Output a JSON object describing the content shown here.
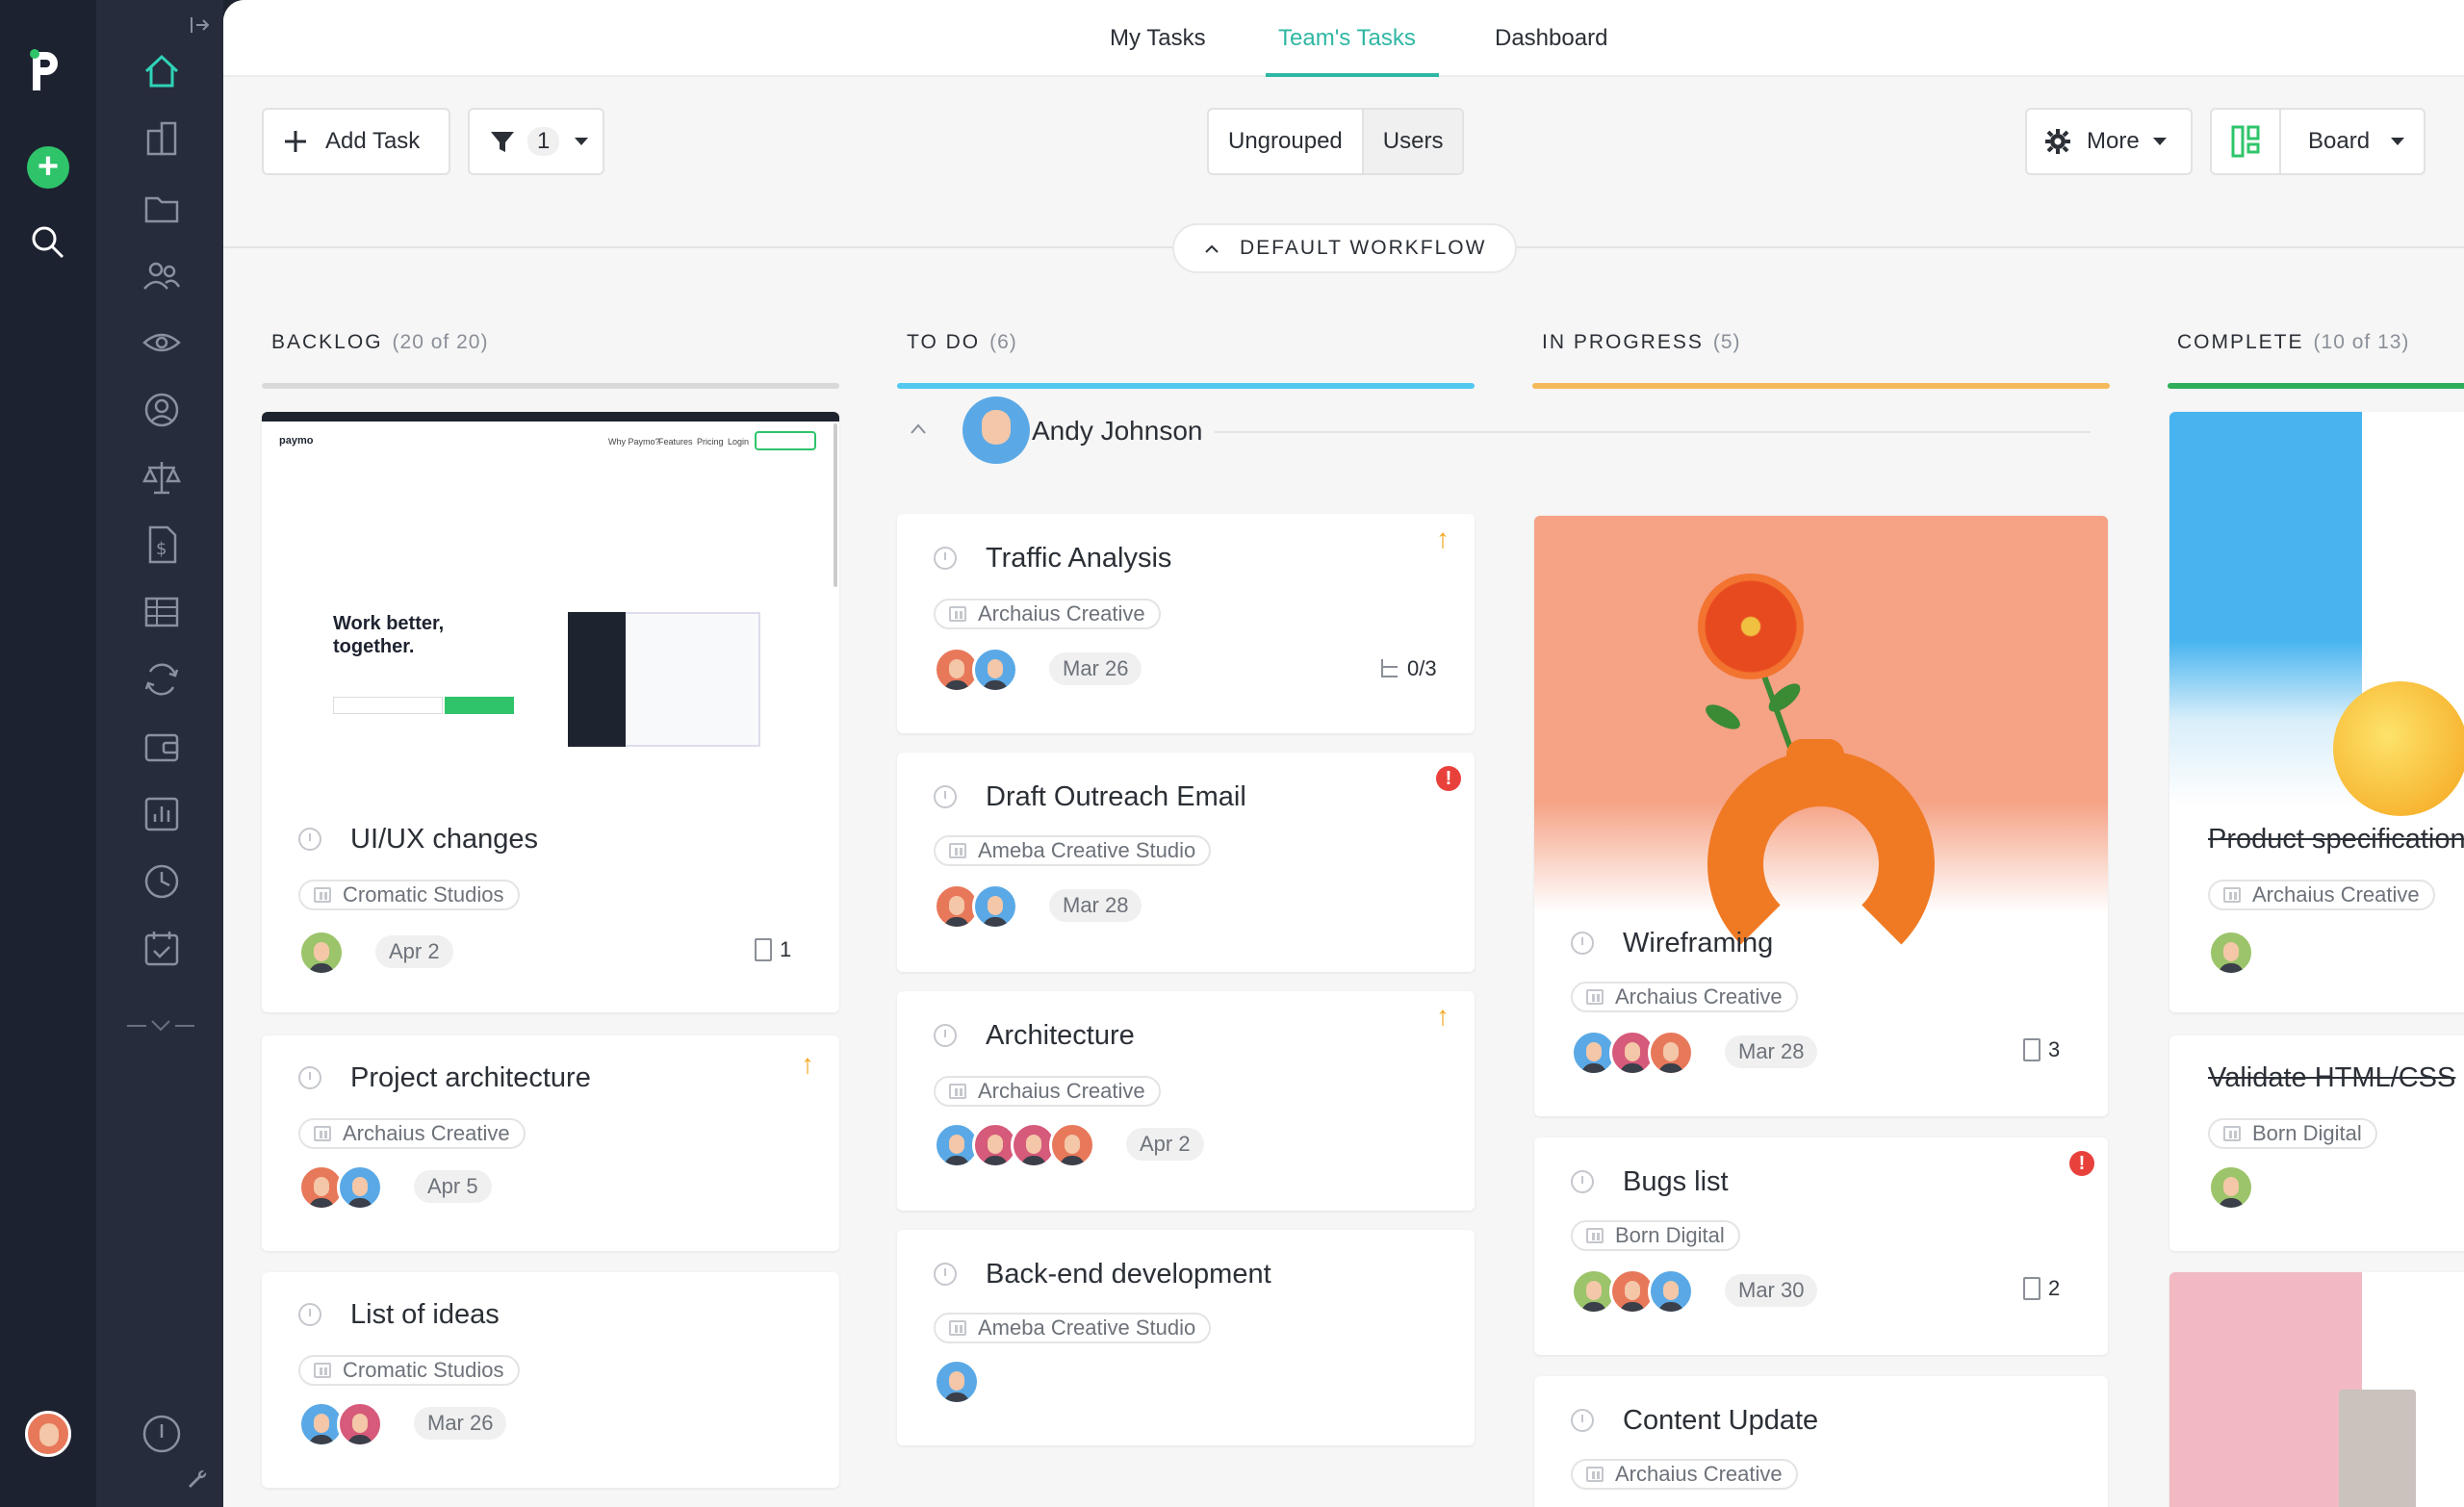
{
  "topnav": {
    "tabs": [
      "My Tasks",
      "Team's Tasks",
      "Dashboard"
    ],
    "active": "Team's Tasks"
  },
  "toolbar": {
    "add_task": "Add Task",
    "filter_count": "1",
    "grouping": [
      "Ungrouped",
      "Users"
    ],
    "grouping_selected": "Users",
    "more": "More",
    "view": "Board"
  },
  "workflow": {
    "label": "DEFAULT WORKFLOW"
  },
  "columns": [
    {
      "name": "BACKLOG",
      "count": "(20 of 20)",
      "color": "#d9d9d9"
    },
    {
      "name": "TO DO",
      "count": "(6)",
      "color": "#52c8f0"
    },
    {
      "name": "IN PROGRESS",
      "count": "(5)",
      "color": "#f4b95a"
    },
    {
      "name": "COMPLETE",
      "count": "(10 of 13)",
      "color": "#2fae59"
    }
  ],
  "group": {
    "user": "Andy Johnson"
  },
  "preview_site": {
    "brand": "paymo",
    "nav": [
      "Why Paymo?",
      "Features",
      "Pricing",
      "Login"
    ],
    "headline_1": "Work better,",
    "headline_2": "together."
  },
  "backlog": [
    {
      "title": "UI/UX changes",
      "project": "Cromatic Studios",
      "date": "Apr 2",
      "files": "1"
    },
    {
      "title": "Project architecture",
      "project": "Archaius Creative",
      "date": "Apr 5"
    },
    {
      "title": "List of ideas",
      "project": "Cromatic Studios",
      "date": "Mar 26"
    }
  ],
  "todo": [
    {
      "title": "Traffic Analysis",
      "project": "Archaius Creative",
      "date": "Mar 26",
      "subtasks": "0/3"
    },
    {
      "title": "Draft Outreach Email",
      "project": "Ameba Creative Studio",
      "date": "Mar 28"
    },
    {
      "title": "Architecture",
      "project": "Archaius Creative",
      "date": "Apr 2"
    },
    {
      "title": "Back-end development",
      "project": "Ameba Creative Studio"
    }
  ],
  "inprogress": [
    {
      "title": "Wireframing",
      "project": "Archaius Creative",
      "date": "Mar 28",
      "files": "3"
    },
    {
      "title": "Bugs list",
      "project": "Born Digital",
      "date": "Mar 30",
      "files": "2"
    },
    {
      "title": "Content Update",
      "project": "Archaius Creative"
    }
  ],
  "complete": [
    {
      "title": "Product specification",
      "project": "Archaius Creative"
    },
    {
      "title": "Validate HTML/CSS",
      "project": "Born Digital"
    }
  ]
}
